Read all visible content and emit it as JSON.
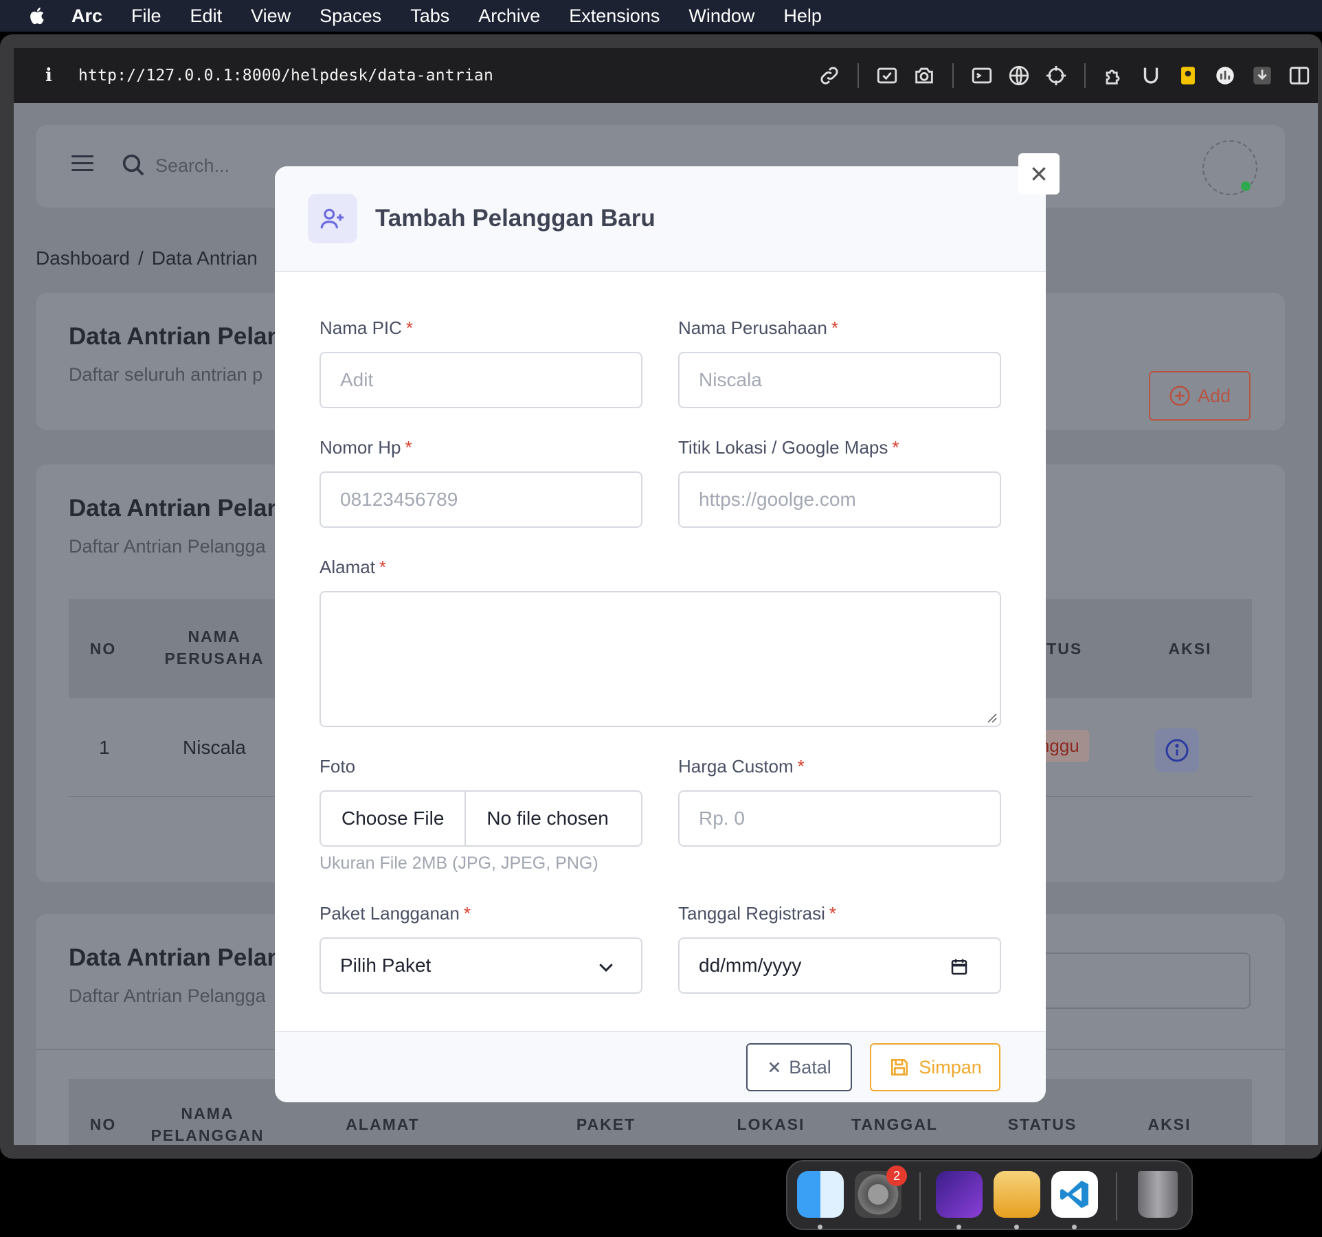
{
  "menubar": {
    "app": "Arc",
    "items": [
      "File",
      "Edit",
      "View",
      "Spaces",
      "Tabs",
      "Archive",
      "Extensions",
      "Window",
      "Help"
    ]
  },
  "browser": {
    "info": "i",
    "url": "http://127.0.0.1:8000/helpdesk/data-antrian"
  },
  "page": {
    "search_placeholder": "Search...",
    "breadcrumb": {
      "home": "Dashboard",
      "separator": "/",
      "current": "Data Antrian"
    },
    "card1": {
      "title": "Data Antrian Pelan",
      "subtitle": "Daftar seluruh antrian p"
    },
    "add_button": "Add",
    "card2": {
      "title": "Data Antrian Pelan",
      "subtitle": "Daftar Antrian Pelangga",
      "headers": {
        "no": "NO",
        "nama": "NAMA\nPERUSAHA",
        "status": "TATUS",
        "aksi": "AKSI"
      },
      "row": {
        "no": "1",
        "nama": "Niscala",
        "status": "nunggu"
      }
    },
    "card3": {
      "title": "Data Antrian Pelan",
      "subtitle": "Daftar Antrian Pelangga",
      "headers": {
        "no": "NO",
        "nama": "NAMA\nPELANGGAN",
        "alamat": "ALAMAT",
        "paket": "PAKET",
        "lokasi": "LOKASI",
        "tanggal": "TANGGAL",
        "status": "STATUS",
        "aksi": "AKSI"
      }
    }
  },
  "modal": {
    "title": "Tambah Pelanggan Baru",
    "required_mark": "*",
    "fields": {
      "nama_pic": {
        "label": "Nama PIC",
        "placeholder": "Adit"
      },
      "nama_perusahaan": {
        "label": "Nama Perusahaan",
        "placeholder": "Niscala"
      },
      "nomor_hp": {
        "label": "Nomor Hp",
        "placeholder": "08123456789"
      },
      "titik_lokasi": {
        "label": "Titik Lokasi / Google Maps",
        "placeholder": "https://goolge.com"
      },
      "alamat": {
        "label": "Alamat"
      },
      "foto": {
        "label": "Foto",
        "button": "Choose File",
        "status": "No file chosen",
        "hint": "Ukuran File 2MB (JPG, JPEG, PNG)"
      },
      "harga_custom": {
        "label": "Harga Custom",
        "placeholder": "Rp. 0"
      },
      "paket": {
        "label": "Paket Langganan",
        "selected": "Pilih Paket"
      },
      "tanggal": {
        "label": "Tanggal Registrasi",
        "value": "dd/mm/yyyy"
      }
    },
    "cancel_button": "Batal",
    "save_button": "Simpan"
  },
  "dock": {
    "settings_badge": "2",
    "apps": [
      "finder-icon",
      "system-settings-icon",
      "arc-icon",
      "sequel-ace-icon",
      "vscode-icon",
      "trash-icon"
    ]
  },
  "colors": {
    "accent_orange": "#f0a92e",
    "required_red": "#d9412f",
    "add_red": "#b55546",
    "modal_icon_purple": "#6b6be0"
  }
}
